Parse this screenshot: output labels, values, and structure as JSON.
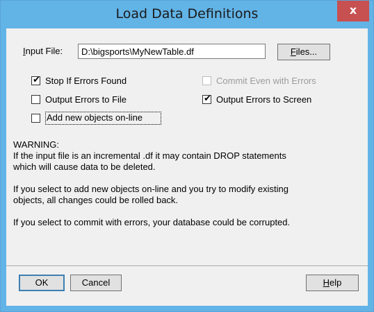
{
  "window": {
    "title": "Load Data Definitions",
    "close_label": "x"
  },
  "form": {
    "input_file_label_u": "I",
    "input_file_label_rest": "nput File:",
    "input_file_value": "D:\\bigsports\\MyNewTable.df",
    "files_button_u": "F",
    "files_button_rest": "iles..."
  },
  "options": {
    "stop_if_errors": {
      "label": "Stop If Errors Found",
      "checked": true
    },
    "output_errors_to_file": {
      "label": "Output Errors to File",
      "checked": false
    },
    "add_new_objects_online": {
      "label": "Add new objects on-line",
      "checked": false
    },
    "commit_even_with_errors": {
      "label": "Commit Even with Errors",
      "checked": false,
      "disabled": true
    },
    "output_errors_to_screen": {
      "label": "Output Errors to Screen",
      "checked": true
    }
  },
  "warning": {
    "heading": "WARNING:",
    "para1_line1": "If the input file is an incremental .df it may contain DROP statements",
    "para1_line2": "which will cause data to be deleted.",
    "para2_line1": "If you select to add new objects on-line and you try to modify existing",
    "para2_line2": "objects, all changes could be rolled back.",
    "para3_line1": "If you select to commit with errors, your database could be corrupted."
  },
  "buttons": {
    "ok": "OK",
    "cancel": "Cancel",
    "help_u": "H",
    "help_rest": "elp"
  },
  "colors": {
    "title_bar": "#62b3e6",
    "close_button": "#c75050",
    "client_background": "#f0f0f0"
  }
}
